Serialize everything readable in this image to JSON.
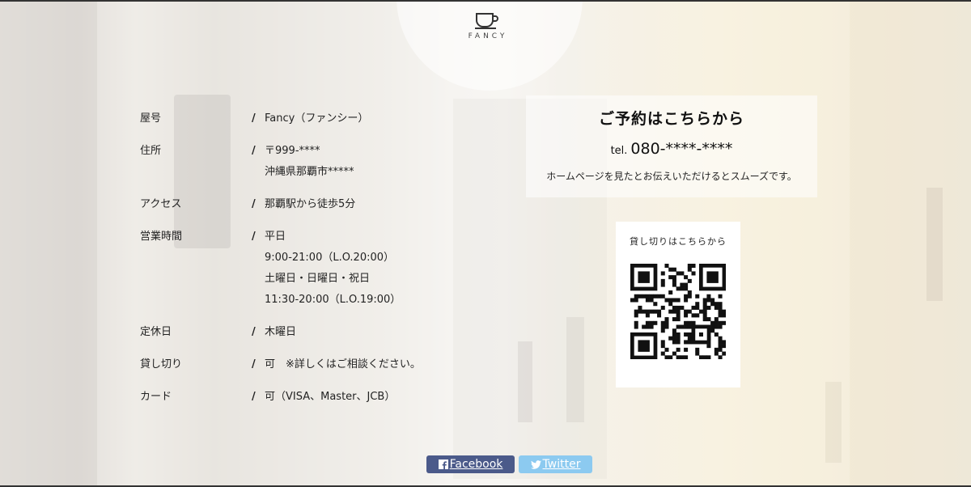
{
  "brand": {
    "name": "FANCY",
    "logo_icon": "cup-icon"
  },
  "info": [
    {
      "label": "屋号",
      "values": [
        "Fancy（ファンシー）"
      ]
    },
    {
      "label": "住所",
      "values": [
        "〒999-****",
        "沖縄県那覇市*****"
      ]
    },
    {
      "label": "アクセス",
      "values": [
        "那覇駅から徒歩5分"
      ]
    },
    {
      "label": "営業時間",
      "values": [
        "平日",
        "9:00-21:00（L.O.20:00）",
        "土曜日・日曜日・祝日",
        "11:30-20:00（L.O.19:00）"
      ]
    },
    {
      "label": "定休日",
      "values": [
        "木曜日"
      ]
    },
    {
      "label": "貸し切り",
      "values": [
        "可　※詳しくはご相談ください。"
      ]
    },
    {
      "label": "カード",
      "values": [
        "可（VISA、Master、JCB）"
      ]
    }
  ],
  "separator": "/",
  "reserve": {
    "heading": "ご予約はこちらから",
    "tel_prefix": "tel.",
    "tel_number": "080-****-****",
    "note": "ホームページを見たとお伝えいただけるとスムーズです。"
  },
  "charter": {
    "caption": "貸し切りはこちらから",
    "qr_icon": "qr-code-icon"
  },
  "social": {
    "facebook_label": "Facebook",
    "facebook_color": "#4b5a8a",
    "twitter_label": "Twitter",
    "twitter_color": "#8ccaf0"
  }
}
